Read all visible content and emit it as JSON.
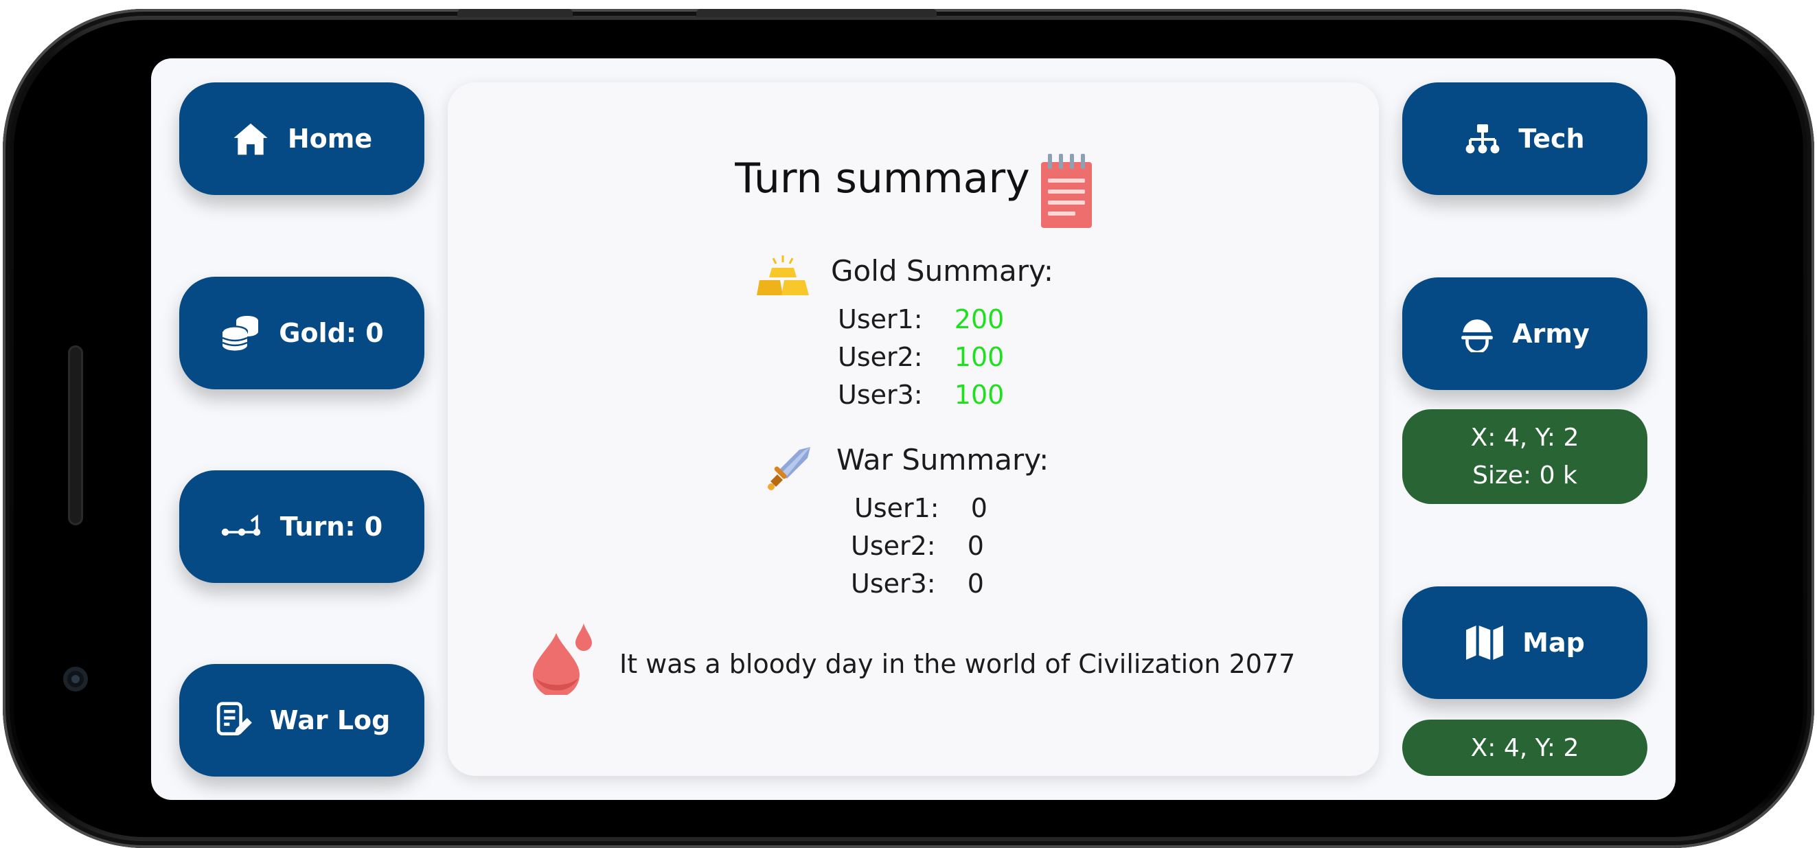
{
  "nav": {
    "home_label": "Home",
    "gold_label": "Gold: 0",
    "turn_label": "Turn: 0",
    "warlog_label": "War Log",
    "tech_label": "Tech",
    "army_label": "Army",
    "map_label": "Map"
  },
  "army_info": {
    "coords": "X: 4, Y: 2",
    "size": "Size: 0 k"
  },
  "map_info": {
    "coords": "X: 4, Y: 2"
  },
  "summary": {
    "title": "Turn summary",
    "gold": {
      "heading": "Gold Summary:",
      "rows": [
        {
          "user": "User1:",
          "value": "200"
        },
        {
          "user": "User2:",
          "value": "100"
        },
        {
          "user": "User3:",
          "value": "100"
        }
      ]
    },
    "war": {
      "heading": "War Summary:",
      "rows": [
        {
          "user": "User1:",
          "value": "0"
        },
        {
          "user": "User2:",
          "value": "0"
        },
        {
          "user": "User3:",
          "value": "0"
        }
      ]
    },
    "message": "It was a bloody day in the world of Civilization 2077"
  },
  "colors": {
    "nav_button": "#054a84",
    "info_pill": "#286434",
    "gold_value": "#1ee01e",
    "blood": "#ee6e6e"
  }
}
